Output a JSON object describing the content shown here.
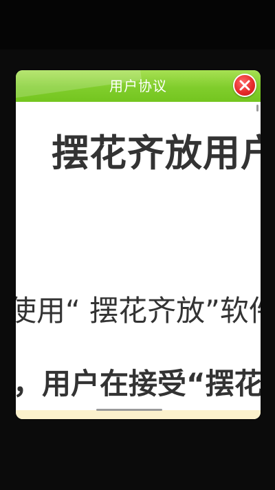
{
  "dialog": {
    "title": "用户协议",
    "close_icon": "close-icon",
    "colors": {
      "header": "#80cd2c",
      "close": "#e62b2b",
      "footer": "#fbf1cc",
      "text": "#333333"
    }
  },
  "content": {
    "doc_title": "摆花齐放用户",
    "para_1": "使用“ 摆花齐放”软件",
    "para_2": "前，用户在接受“摆花"
  }
}
